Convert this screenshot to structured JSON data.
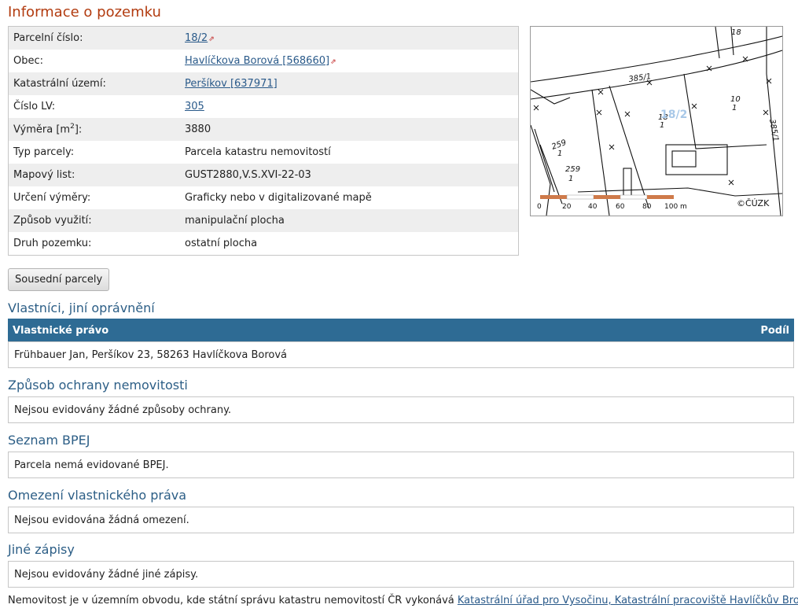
{
  "title": "Informace o pozemku",
  "parcel_rows": [
    {
      "label": "Parcelní číslo:",
      "value": "18/2",
      "link": true,
      "external": true
    },
    {
      "label": "Obec:",
      "value": "Havlíčkova Borová [568660]",
      "link": true,
      "external": true
    },
    {
      "label": "Katastrální území:",
      "value": "Peršíkov [637971]",
      "link": true,
      "external": false
    },
    {
      "label": "Číslo LV:",
      "value": "305",
      "link": true,
      "external": false
    },
    {
      "label": "Výměra [m",
      "label_sup": "2",
      "label_suffix": "]:",
      "value": "3880",
      "link": false
    },
    {
      "label": "Typ parcely:",
      "value": "Parcela katastru nemovitostí",
      "link": false
    },
    {
      "label": "Mapový list:",
      "value": "GUST2880,V.S.XVI-22-03",
      "link": false
    },
    {
      "label": "Určení výměry:",
      "value": "Graficky nebo v digitalizované mapě",
      "link": false
    },
    {
      "label": "Způsob využití:",
      "value": "manipulační plocha",
      "link": false
    },
    {
      "label": "Druh pozemku:",
      "value": "ostatní plocha",
      "link": false
    }
  ],
  "map": {
    "parcel_label": "18/2",
    "copyright": "©ČÚZK",
    "labels": [
      "18",
      "385/1",
      "18",
      "1",
      "10",
      "1",
      "385/1",
      "259",
      "1",
      "259",
      "1"
    ],
    "scale_ticks": [
      "0",
      "20",
      "40",
      "60",
      "80",
      "100 m"
    ]
  },
  "neighbors_button": "Sousední parcely",
  "owners": {
    "heading": "Vlastníci, jiní oprávnění",
    "col_right": "Vlastnické právo",
    "col_share": "Podíl",
    "row": "Frühbauer Jan, Peršíkov 23, 58263 Havlíčkova Borová"
  },
  "sections": [
    {
      "heading": "Způsob ochrany nemovitosti",
      "text": "Nejsou evidovány žádné způsoby ochrany."
    },
    {
      "heading": "Seznam BPEJ",
      "text": "Parcela nemá evidované BPEJ."
    },
    {
      "heading": "Omezení vlastnického práva",
      "text": "Nejsou evidována žádná omezení."
    },
    {
      "heading": "Jiné zápisy",
      "text": "Nejsou evidovány žádné jiné zápisy."
    }
  ],
  "footer": {
    "text": "Nemovitost je v územním obvodu, kde státní správu katastru nemovitostí ČR vykonává ",
    "link": "Katastrální úřad pro Vysočinu, Katastrální pracoviště Havlíčkův Brod"
  },
  "colors": {
    "title": "#b23b0f",
    "section_heading": "#2c5e86",
    "table_header_bg": "#2e6b94",
    "link": "#2a5a8a"
  }
}
